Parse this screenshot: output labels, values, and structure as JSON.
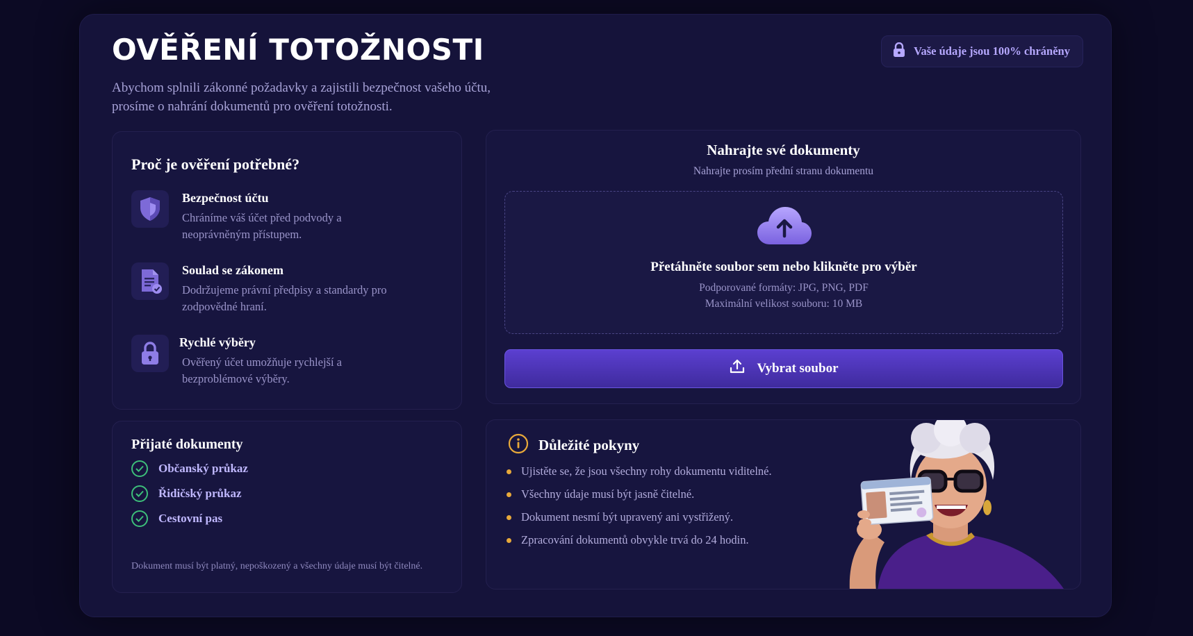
{
  "header": {
    "title": "OVĚŘENÍ TOTOŽNOSTI",
    "subtitle": "Abychom splnili zákonné požadavky a zajistili bezpečnost vašeho účtu, prosíme o nahrání dokumentů pro ověření totožnosti.",
    "secure_badge": "Vaše údaje jsou 100% chráněny"
  },
  "why": {
    "heading": "Proč je ověření potřebné?",
    "items": [
      {
        "icon": "shield-icon",
        "title": "Bezpečnost účtu",
        "desc": "Chráníme váš účet před podvody a neoprávněným přístupem."
      },
      {
        "icon": "document-check-icon",
        "title": "Soulad se zákonem",
        "desc": "Dodržujeme právní předpisy a standardy pro zodpovědné hraní."
      },
      {
        "icon": "lock-icon",
        "title": "Rychlé výběry",
        "desc": "Ověřený účet umožňuje rychlejší a bezproblémové výběry."
      }
    ]
  },
  "documents": {
    "heading": "Přijaté dokumenty",
    "items": [
      "Občanský průkaz",
      "Řidičský průkaz",
      "Cestovní pas"
    ],
    "note": "Dokument musí být platný, nepoškozený a všechny údaje musí být čitelné."
  },
  "upload": {
    "heading": "Nahrajte své dokumenty",
    "subheading": "Nahrajte prosím přední stranu dokumentu",
    "drop_text": "Přetáhněte soubor sem nebo klikněte pro výběr",
    "formats": "Podporované formáty: JPG, PNG, PDF",
    "max_size": "Maximální velikost souboru: 10 MB",
    "button_label": "Vybrat soubor"
  },
  "guidelines": {
    "heading": "Důležité pokyny",
    "items": [
      "Ujistěte se, že jsou všechny rohy dokumentu viditelné.",
      "Všechny údaje musí být jasně čitelné.",
      "Dokument nesmí být upravený ani vystřižený.",
      "Zpracování dokumentů obvykle trvá do 24 hodin."
    ]
  },
  "colors": {
    "background": "#0c0a24",
    "panel": "#15133a",
    "card": "#17153f",
    "accent": "#5b3fd0",
    "accent_text": "#b6a8ff",
    "check": "#3dbf7a",
    "bullet": "#e8a93a"
  }
}
